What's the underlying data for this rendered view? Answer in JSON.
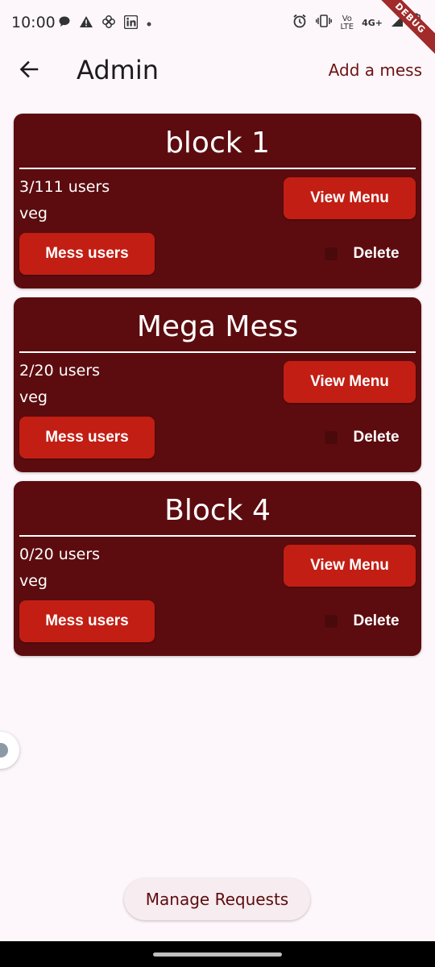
{
  "status_bar": {
    "time": "10:00",
    "network_label_top": "Vo",
    "network_label_bottom": "LTE",
    "network_type": "4G+",
    "debug_banner": "DEBUG"
  },
  "app_bar": {
    "title": "Admin",
    "action_label": "Add a mess"
  },
  "messes": [
    {
      "name": "block 1",
      "users": "3/111 users",
      "type": "veg",
      "view_menu_label": "View Menu",
      "mess_users_label": "Mess users",
      "delete_label": "Delete"
    },
    {
      "name": "Mega Mess",
      "users": "2/20 users",
      "type": "veg",
      "view_menu_label": "View Menu",
      "mess_users_label": "Mess users",
      "delete_label": "Delete"
    },
    {
      "name": "Block 4",
      "users": "0/20 users",
      "type": "veg",
      "view_menu_label": "View Menu",
      "mess_users_label": "Mess users",
      "delete_label": "Delete"
    }
  ],
  "manage_requests_label": "Manage Requests",
  "colors": {
    "card_background": "#5c0c0f",
    "button_red": "#c21e14",
    "page_background": "#fdf7fb",
    "accent_text": "#6b1414"
  },
  "icons": {
    "back": "arrow-left-icon",
    "status": [
      "chat-bubble-icon",
      "warning-icon",
      "pinwheel-icon",
      "linkedin-icon",
      "dot-icon",
      "alarm-icon",
      "vibrate-icon",
      "battery-icon"
    ]
  }
}
